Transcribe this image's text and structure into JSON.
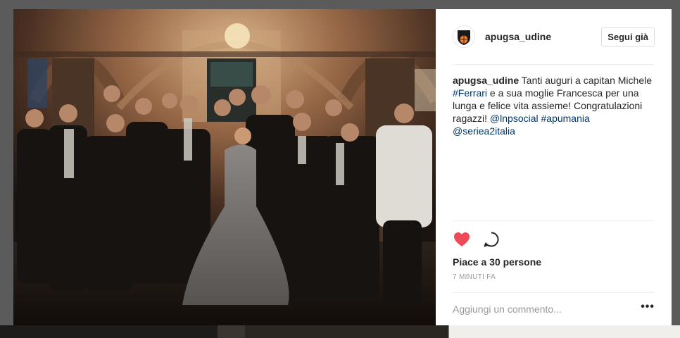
{
  "post": {
    "author": {
      "username": "apugsa_udine",
      "avatar_text": "APU",
      "follow_label": "Segui già"
    },
    "photo": {
      "icon": "group-photo"
    },
    "caption": {
      "username": "apugsa_udine",
      "text_1": "Tanti auguri a capitan Michele ",
      "hashtag_1": "#Ferrari",
      "text_2": " e a sua moglie Francesca per una lunga e felice vita assieme! Congratulazioni ragazzi! ",
      "mention_1": "@lnpsocial",
      "text_3": " ",
      "hashtag_2": "#apumania",
      "text_4": " ",
      "mention_2": "@seriea2italia"
    },
    "actions": {
      "like_icon": "heart-icon",
      "comment_icon": "comment-icon",
      "like_color": "#ed4956"
    },
    "likes_label": "Piace a 30 persone",
    "timestamp": "7 MINUTI FA",
    "comment": {
      "placeholder": "Aggiungi un commento...",
      "value": "",
      "more_label": "•••"
    }
  }
}
